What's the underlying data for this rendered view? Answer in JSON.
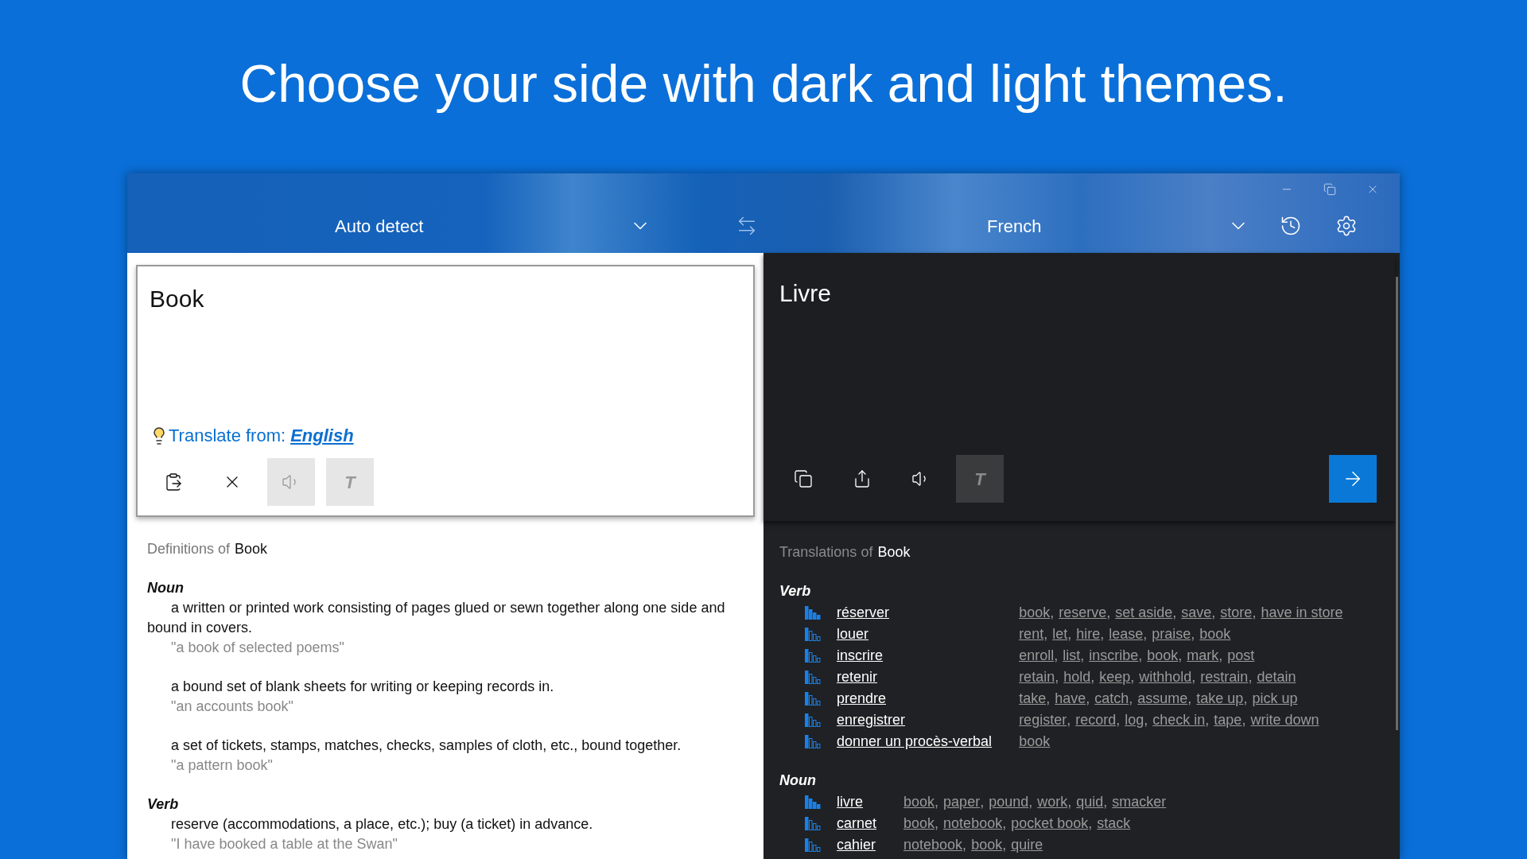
{
  "headline": "Choose your side with dark and light themes.",
  "window": {
    "controls": [
      {
        "kind": "minimize"
      },
      {
        "kind": "restore"
      },
      {
        "kind": "close"
      }
    ]
  },
  "toolbar": {
    "source_language": "Auto detect",
    "target_language": "French"
  },
  "input": {
    "value": "Book",
    "hint": {
      "label": "Translate from:",
      "language": "English"
    },
    "buttons": [
      {
        "kind": "paste",
        "disabled": false
      },
      {
        "kind": "clear",
        "disabled": false
      },
      {
        "kind": "speak",
        "disabled": true
      },
      {
        "kind": "font",
        "label": "T",
        "disabled": true
      }
    ]
  },
  "output": {
    "value": "Livre",
    "buttons": [
      {
        "kind": "copy",
        "disabled": false
      },
      {
        "kind": "share",
        "disabled": false
      },
      {
        "kind": "speak",
        "disabled": false
      },
      {
        "kind": "font",
        "label": "T",
        "disabled": true
      },
      {
        "kind": "go",
        "disabled": false
      }
    ]
  },
  "definitions": {
    "label": "Definitions of",
    "word": "Book",
    "sections": [
      {
        "pos": "Noun",
        "senses": [
          {
            "definition": "a written or printed work consisting of pages glued or sewn together along one side and bound in covers.",
            "example": "\"a book of selected poems\""
          },
          {
            "definition": "a bound set of blank sheets for writing or keeping records in.",
            "example": "\"an accounts book\""
          },
          {
            "definition": "a set of tickets, stamps, matches, checks, samples of cloth, etc., bound together.",
            "example": "\"a pattern book\""
          }
        ]
      },
      {
        "pos": "Verb",
        "senses": [
          {
            "definition": "reserve (accommodations, a place, etc.); buy (a ticket) in advance.",
            "example": "\"I have booked a table at the Swan\""
          }
        ]
      }
    ]
  },
  "translations": {
    "label": "Translations of",
    "word": "Book",
    "separator": ",",
    "sections": [
      {
        "pos": "Verb",
        "rows": [
          {
            "word": "réserver",
            "common": true,
            "alternatives": [
              "book",
              "reserve",
              "set aside",
              "save",
              "store",
              "have in store"
            ]
          },
          {
            "word": "louer",
            "common": false,
            "alternatives": [
              "rent",
              "let",
              "hire",
              "lease",
              "praise",
              "book"
            ]
          },
          {
            "word": "inscrire",
            "common": false,
            "alternatives": [
              "enroll",
              "list",
              "inscribe",
              "book",
              "mark",
              "post"
            ]
          },
          {
            "word": "retenir",
            "common": false,
            "alternatives": [
              "retain",
              "hold",
              "keep",
              "withhold",
              "restrain",
              "detain"
            ]
          },
          {
            "word": "prendre",
            "common": false,
            "alternatives": [
              "take",
              "have",
              "catch",
              "assume",
              "take up",
              "pick up"
            ]
          },
          {
            "word": "enregistrer",
            "common": false,
            "alternatives": [
              "register",
              "record",
              "log",
              "check in",
              "tape",
              "write down"
            ]
          },
          {
            "word": "donner un procès-verbal",
            "common": false,
            "alternatives": [
              "book"
            ]
          }
        ]
      },
      {
        "pos": "Noun",
        "rows": [
          {
            "word": "livre",
            "common": true,
            "alternatives": [
              "book",
              "paper",
              "pound",
              "work",
              "quid",
              "smacker"
            ]
          },
          {
            "word": "carnet",
            "common": false,
            "alternatives": [
              "book",
              "notebook",
              "pocket book",
              "stack"
            ]
          },
          {
            "word": "cahier",
            "common": false,
            "alternatives": [
              "notebook",
              "book",
              "quire"
            ]
          }
        ]
      }
    ]
  }
}
